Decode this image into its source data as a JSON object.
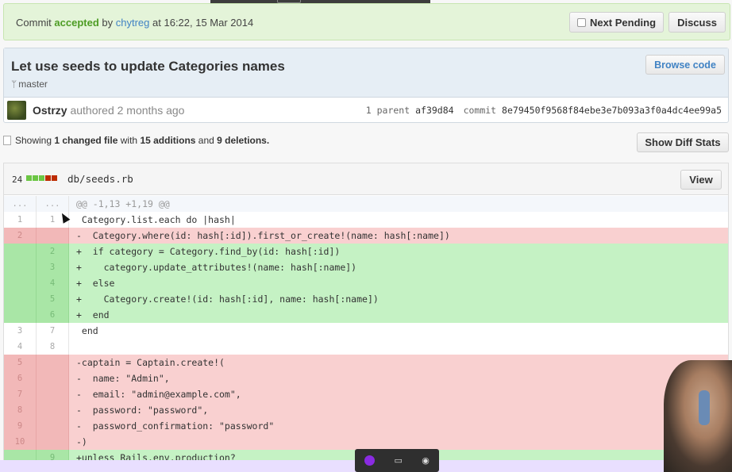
{
  "status": {
    "prefix": "Commit",
    "state": "accepted",
    "by": "by",
    "user": "chytreg",
    "when": "at 16:22, 15 Mar 2014",
    "next_pending_label": "Next Pending",
    "discuss_label": "Discuss"
  },
  "commit": {
    "title": "Let use seeds to update Categories names",
    "branch": "master",
    "browse_label": "Browse code",
    "author": "Ostrzy",
    "authored_text": "authored 2 months ago",
    "parent_count": "1 parent",
    "parent_sha": "af39d84",
    "commit_label": "commit",
    "commit_sha": "8e79450f9568f84ebe3e7b093a3f0a4dc4ee99a5"
  },
  "toc": {
    "showing": "Showing",
    "changed_files": "1 changed file",
    "with": "with",
    "additions": "15 additions",
    "and": "and",
    "deletions": "9 deletions.",
    "show_diff_stats_label": "Show Diff Stats"
  },
  "file": {
    "change_count": "24",
    "name": "db/seeds.rb",
    "view_label": "View",
    "stat_colors": [
      "#6cc644",
      "#6cc644",
      "#6cc644",
      "#bd2c00",
      "#bd2c00"
    ]
  },
  "diff_lines": [
    {
      "type": "hunk",
      "old": "...",
      "new": "...",
      "code": "@@ -1,13 +1,19 @@"
    },
    {
      "type": "ctx",
      "old": "1",
      "new": "1",
      "code": " Category.list.each do |hash|"
    },
    {
      "type": "del",
      "old": "2",
      "new": "",
      "code": "-  Category.where(id: hash[:id]).first_or_create!(name: hash[:name])"
    },
    {
      "type": "add",
      "old": "",
      "new": "2",
      "code": "+  if category = Category.find_by(id: hash[:id])"
    },
    {
      "type": "add",
      "old": "",
      "new": "3",
      "code": "+    category.update_attributes!(name: hash[:name])"
    },
    {
      "type": "add",
      "old": "",
      "new": "4",
      "code": "+  else"
    },
    {
      "type": "add",
      "old": "",
      "new": "5",
      "code": "+    Category.create!(id: hash[:id], name: hash[:name])"
    },
    {
      "type": "add",
      "old": "",
      "new": "6",
      "code": "+  end"
    },
    {
      "type": "ctx",
      "old": "3",
      "new": "7",
      "code": " end"
    },
    {
      "type": "ctx",
      "old": "4",
      "new": "8",
      "code": ""
    },
    {
      "type": "del",
      "old": "5",
      "new": "",
      "code": "-captain = Captain.create!("
    },
    {
      "type": "del",
      "old": "6",
      "new": "",
      "code": "-  name: \"Admin\","
    },
    {
      "type": "del",
      "old": "7",
      "new": "",
      "code": "-  email: \"admin@example.com\","
    },
    {
      "type": "del",
      "old": "8",
      "new": "",
      "code": "-  password: \"password\","
    },
    {
      "type": "del",
      "old": "9",
      "new": "",
      "code": "-  password_confirmation: \"password\""
    },
    {
      "type": "del",
      "old": "10",
      "new": "",
      "code": "-)"
    },
    {
      "type": "add",
      "old": "",
      "new": "9",
      "code": "+unless Rails.env.production?"
    }
  ]
}
